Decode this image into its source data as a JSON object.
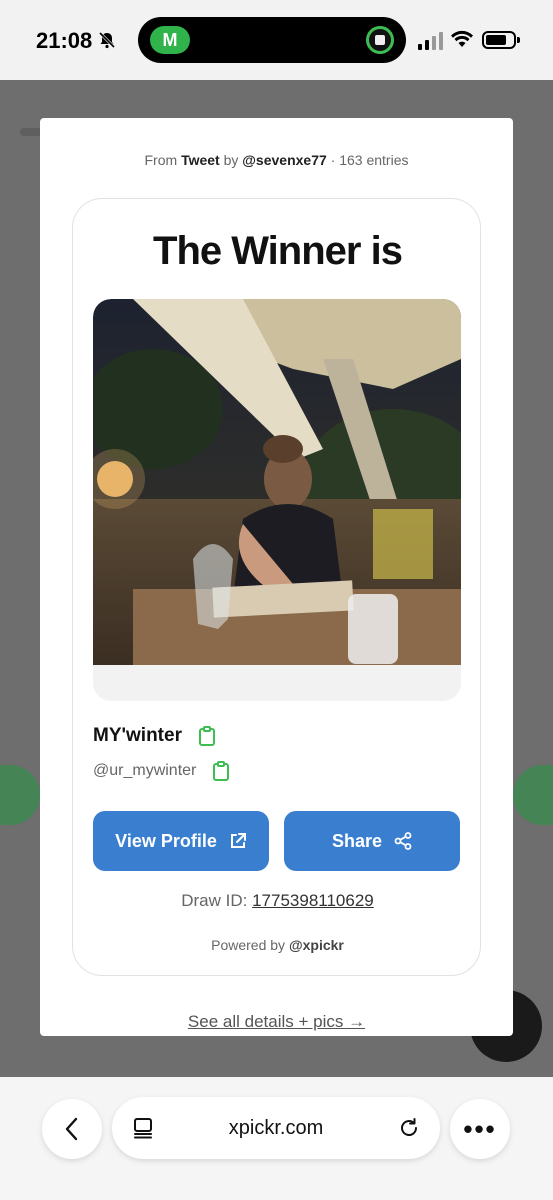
{
  "status_bar": {
    "time": "21:08",
    "island_app_letter": "M"
  },
  "modal": {
    "source_from": "From",
    "source_type": "Tweet",
    "source_by": "by",
    "source_user": "@sevenxe77",
    "source_entries": "· 163 entries",
    "title": "The Winner is",
    "winner_name": "MY'winter",
    "winner_handle": "@ur_mywinter",
    "view_profile_label": "View Profile",
    "share_label": "Share",
    "draw_id_label": "Draw ID:",
    "draw_id_value": "1775398110629",
    "powered_by_label": "Powered by",
    "powered_by_brand": "@xpickr",
    "see_all_label": "See all details + pics →"
  },
  "browser": {
    "url": "xpickr.com",
    "more_label": "•••"
  },
  "colors": {
    "accent_blue": "#3a7fcf",
    "clipboard_green": "#3dbd52",
    "island_green": "#2fb34a"
  },
  "icons": {
    "bell": "bell-slash-icon",
    "view_profile": "external-link-icon",
    "share": "share-icon",
    "copy": "clipboard-icon",
    "back": "chevron-left-icon",
    "tabs": "tabs-icon",
    "reload": "reload-icon"
  }
}
